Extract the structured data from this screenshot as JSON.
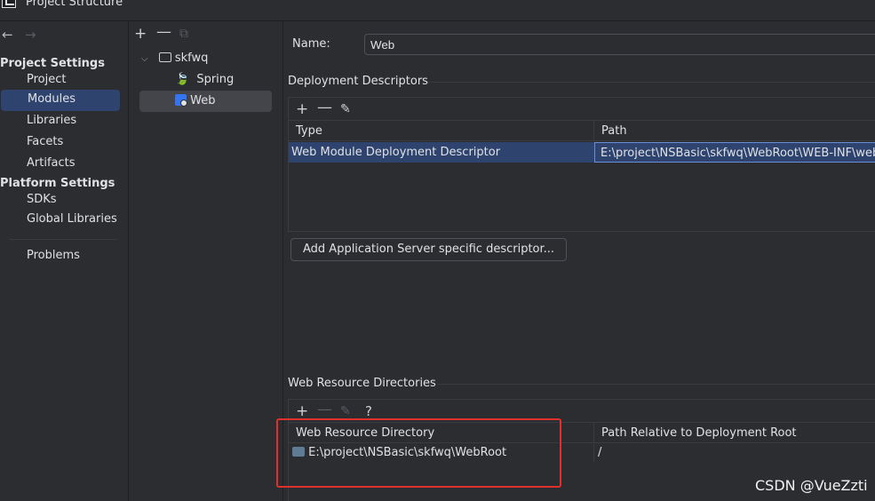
{
  "window": {
    "title": "Project Structure"
  },
  "nav": {
    "back": "←",
    "forward": "→",
    "project_settings_title": "Project Settings",
    "project_settings_items": [
      "Project",
      "Modules",
      "Libraries",
      "Facets",
      "Artifacts"
    ],
    "platform_settings_title": "Platform Settings",
    "platform_settings_items": [
      "SDKs",
      "Global Libraries"
    ],
    "problems": "Problems",
    "selected": "Modules"
  },
  "tree": {
    "toolbar": {
      "add": "+",
      "remove": "—",
      "copy": "⧉"
    },
    "root": "skfwq",
    "children": [
      "Spring",
      "Web"
    ],
    "selected": "Web"
  },
  "details": {
    "name_label": "Name:",
    "name_value": "Web",
    "deployment_descriptors": {
      "title": "Deployment Descriptors",
      "toolbar": {
        "add": "+",
        "remove": "—",
        "edit": "✎"
      },
      "columns": [
        "Type",
        "Path"
      ],
      "rows": [
        {
          "type": "Web Module Deployment Descriptor",
          "path": "E:\\project\\NSBasic\\skfwq\\WebRoot\\WEB-INF\\web.xml"
        }
      ],
      "add_server_button": "Add Application Server specific descriptor..."
    },
    "web_resource_directories": {
      "title": "Web Resource Directories",
      "toolbar": {
        "add": "+",
        "remove": "—",
        "edit": "✎",
        "help": "?"
      },
      "columns": [
        "Web Resource Directory",
        "Path Relative to Deployment Root"
      ],
      "rows": [
        {
          "directory": "E:\\project\\NSBasic\\skfwq\\WebRoot",
          "relative": "/"
        }
      ]
    }
  },
  "watermark": "CSDN @VueZzti",
  "colors": {
    "selection": "#2e436e",
    "highlight_box": "#e0302c",
    "background": "#2b2d30"
  }
}
